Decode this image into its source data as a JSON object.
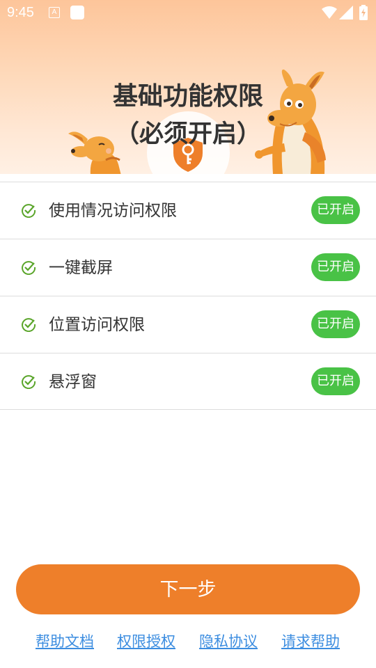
{
  "status_bar": {
    "time": "9:45",
    "icons": [
      "a-notification-icon",
      "square-notification-icon",
      "wifi-icon",
      "signal-icon",
      "battery-charging-icon"
    ]
  },
  "header": {
    "title_line1": "基础功能权限",
    "title_line2": "（必须开启）",
    "illustration": [
      "kangaroo-small",
      "kangaroo-big",
      "key-shield-icon"
    ],
    "colors": {
      "gradient_top": "#fdc59a",
      "gradient_bottom": "#fff0e4",
      "shield": "#ee7f2a"
    }
  },
  "permissions": [
    {
      "label": "使用情况访问权限",
      "status": "已开启",
      "icon": "check-circle-icon"
    },
    {
      "label": "一键截屏",
      "status": "已开启",
      "icon": "check-circle-icon"
    },
    {
      "label": "位置访问权限",
      "status": "已开启",
      "icon": "check-circle-icon"
    },
    {
      "label": "悬浮窗",
      "status": "已开启",
      "icon": "check-circle-icon"
    }
  ],
  "next_button": {
    "label": "下一步",
    "color": "#ee7f2a"
  },
  "footer": {
    "links": [
      "帮助文档",
      "权限授权",
      "隐私协议",
      "请求帮助"
    ],
    "link_color": "#3c8de0"
  },
  "colors": {
    "status_on": "#49c246",
    "check": "#5aa52a",
    "text": "#333333",
    "divider": "#dcdcdc"
  }
}
